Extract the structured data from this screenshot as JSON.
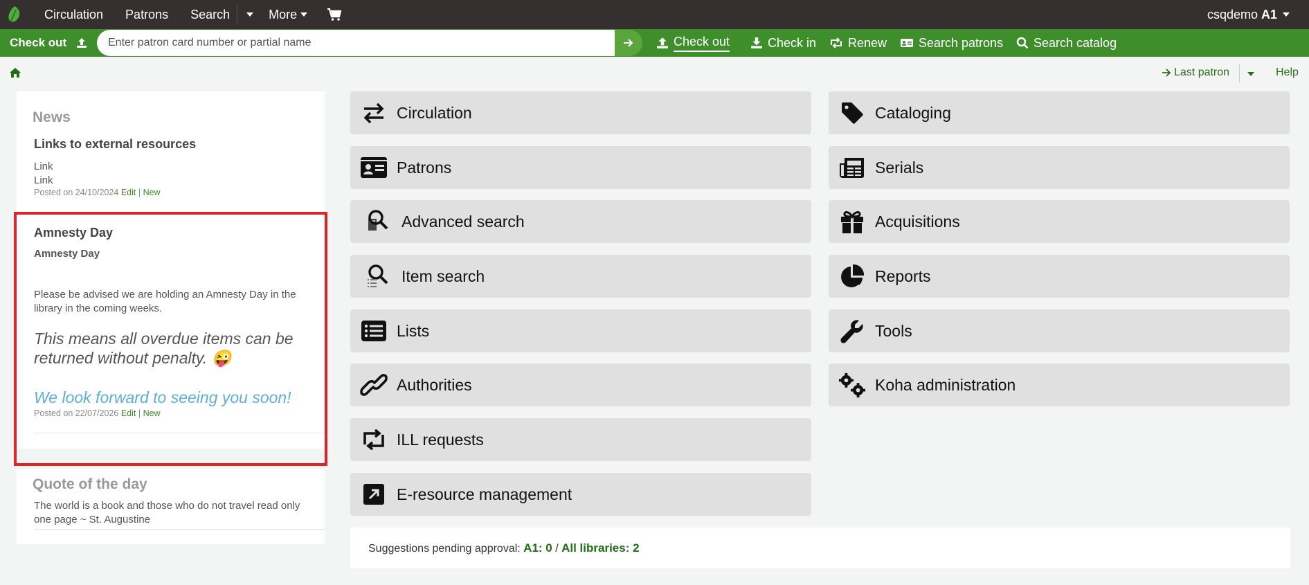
{
  "topnav": {
    "items": [
      "Circulation",
      "Patrons",
      "Search",
      "More"
    ],
    "user_name": "csqdemo",
    "user_branch": "A1"
  },
  "checkout_bar": {
    "label": "Check out",
    "placeholder": "Enter patron card number or partial name",
    "links": [
      "Check out",
      "Check in",
      "Renew",
      "Search patrons",
      "Search catalog"
    ]
  },
  "breadcrumb": {
    "last_patron": "Last patron",
    "help": "Help"
  },
  "news": {
    "heading": "News",
    "items": [
      {
        "title": "Links to external resources",
        "lines": [
          "Link",
          "Link"
        ],
        "posted": "Posted on 24/10/2024",
        "edit": "Edit",
        "sep": "|",
        "new": "New"
      },
      {
        "title": "Amnesty Day",
        "subtitle": "Amnesty Day",
        "body": "Please be advised we are holding an Amnesty Day in the library in the coming weeks.",
        "italic": "This means all overdue items can be returned without penalty.",
        "emoji": "😜",
        "closing": "We look forward to seeing you soon!",
        "posted": "Posted on 22/07/2026",
        "edit": "Edit",
        "sep": "|",
        "new": "New"
      }
    ]
  },
  "quote": {
    "heading": "Quote of the day",
    "text": "The world is a book and those who do not travel read only one page ~ St. Augustine"
  },
  "modules": {
    "left": [
      "Circulation",
      "Patrons",
      "Advanced search",
      "Item search",
      "Lists",
      "Authorities",
      "ILL requests",
      "E-resource management"
    ],
    "right": [
      "Cataloging",
      "Serials",
      "Acquisitions",
      "Reports",
      "Tools",
      "Koha administration"
    ]
  },
  "suggestions": {
    "label": "Suggestions pending approval:",
    "a1": "A1: 0",
    "sep": "/",
    "all": "All libraries: 2"
  },
  "colors": {
    "topbar": "#352f2f",
    "greenbar": "#3e8f2c",
    "highlight": "#e32227",
    "link_green": "#3a8b24"
  }
}
